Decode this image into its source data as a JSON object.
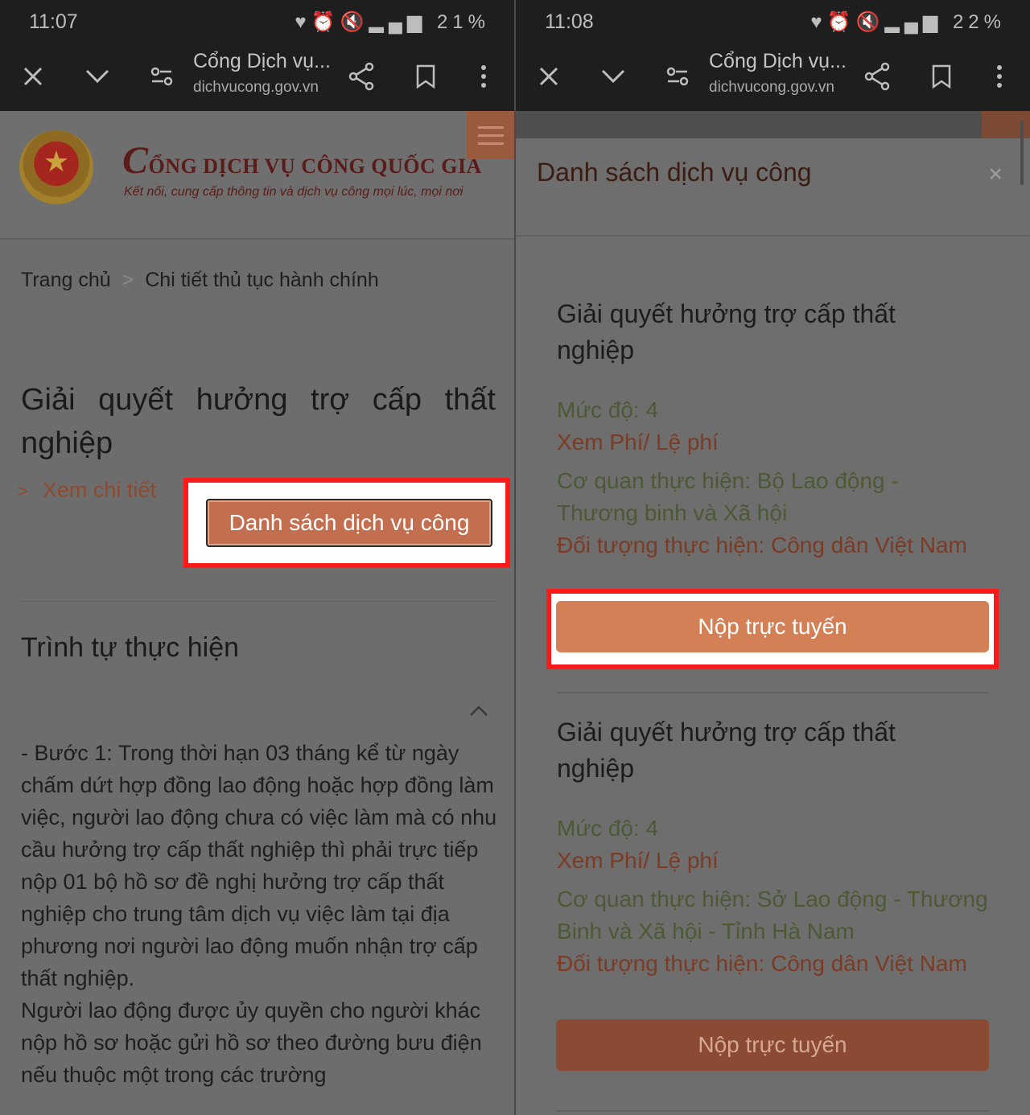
{
  "left": {
    "status": {
      "time": "11:07",
      "battery": "21%"
    },
    "toolbar": {
      "title": "Cổng Dịch vụ...",
      "url": "dichvucong.gov.vn"
    },
    "site": {
      "title_initial": "C",
      "title_rest": "ỔNG DỊCH VỤ CÔNG QUỐC GIA",
      "subtitle": "Kết nối, cung cấp thông tin và dịch vụ công mọi lúc, mọi nơi"
    },
    "breadcrumb": {
      "home": "Trang chủ",
      "sep": ">",
      "current": "Chi tiết thủ tục hành chính"
    },
    "procedure_title": "Giải quyết hưởng trợ cấp thất nghiệp",
    "detail_link": "Xem chi tiết",
    "detail_chevron": ">",
    "services_button": "Danh sách dịch vụ công",
    "section_title": "Trình tự thực hiện",
    "body": [
      "- Bước 1: Trong thời hạn 03 tháng kể từ ngày chấm dứt hợp đồng lao động hoặc hợp đồng làm việc, người lao động chưa có việc làm mà có nhu cầu hưởng trợ cấp thất nghiệp thì phải trực tiếp nộp 01 bộ hồ sơ đề nghị hưởng trợ cấp thất nghiệp cho trung tâm dịch vụ việc làm tại địa phương nơi người lao động muốn nhận trợ cấp thất nghiệp.",
      "Người lao động được ủy quyền cho người khác nộp hồ sơ hoặc gửi hồ sơ theo đường bưu điện nếu thuộc một trong các trường"
    ]
  },
  "right": {
    "status": {
      "time": "11:08",
      "battery": "22%"
    },
    "toolbar": {
      "title": "Cổng Dịch vụ...",
      "url": "dichvucong.gov.vn"
    },
    "modal": {
      "title": "Danh sách dịch vụ công",
      "close": "×",
      "cards": [
        {
          "title": "Giải quyết hưởng trợ cấp thất nghiệp",
          "level": "Mức độ: 4",
          "fee": "Xem Phí/ Lệ phí",
          "agency": "Cơ quan thực hiện: Bộ Lao động - Thương binh và Xã hội",
          "target": "Đối tượng thực hiện: Công dân Việt Nam",
          "button": "Nộp trực tuyến"
        },
        {
          "title": "Giải quyết hưởng trợ cấp thất nghiệp",
          "level": "Mức độ: 4",
          "fee": "Xem Phí/ Lệ phí",
          "agency": "Cơ quan thực hiện: Sở Lao động - Thương Binh và Xã hội - Tỉnh Hà Nam",
          "target": "Đối tượng thực hiện: Công dân Việt Nam",
          "button": "Nộp trực tuyến"
        }
      ]
    }
  },
  "colors": {
    "accent": "#d48056",
    "highlight": "#ff1a1a",
    "dark_bar": "#1e1e1e"
  }
}
